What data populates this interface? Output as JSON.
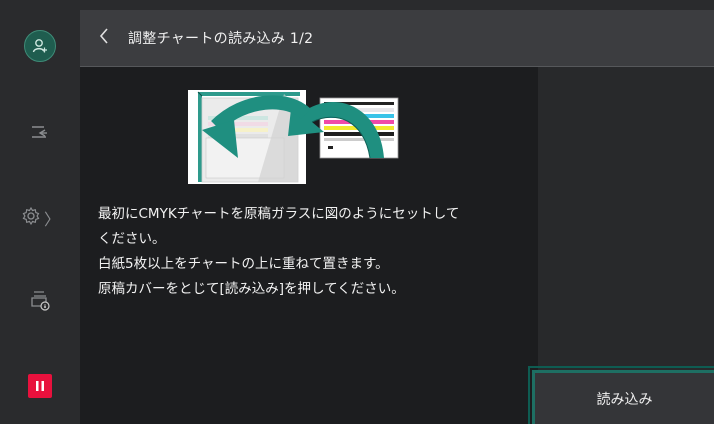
{
  "header": {
    "title": "調整チャートの読み込み 1/2"
  },
  "sidebar": {
    "items": [
      {
        "icon": "user-icon"
      },
      {
        "icon": "job-flow-icon"
      },
      {
        "icon": "settings-icon",
        "chevron": "〉"
      },
      {
        "icon": "device-info-icon"
      },
      {
        "icon": "pause-icon",
        "color": "#e8113d"
      }
    ]
  },
  "main": {
    "instructions": [
      "最初にCMYKチャートを原稿ガラスに図のようにセットして",
      "ください。",
      "白紙5枚以上をチャートの上に重ねて置きます。",
      "原稿カバーをとじて[読み込み]を押してください。"
    ]
  },
  "actions": {
    "read_label": "読み込み"
  },
  "colors": {
    "accent": "#1e6f63",
    "pause": "#e8113d"
  }
}
